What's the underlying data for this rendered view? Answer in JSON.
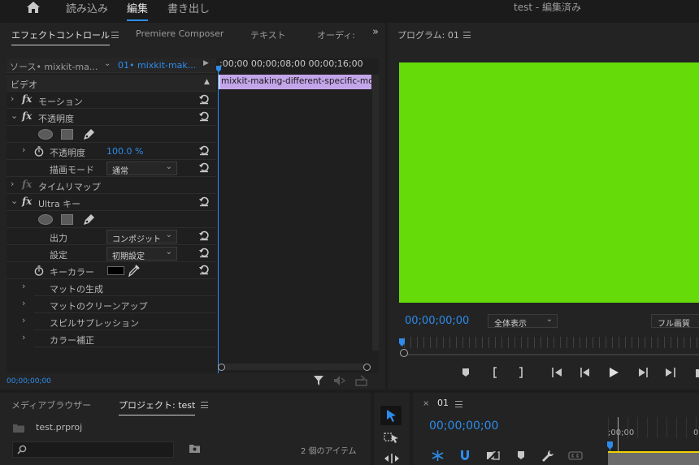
{
  "topbar": {
    "workspaces": [
      "読み込み",
      "編集",
      "書き出し"
    ],
    "active": "編集",
    "title": "test - 編集済み"
  },
  "effect_panel": {
    "tabs": [
      "エフェクトコントロール",
      "Premiere Composer",
      "テキスト",
      "オーディ:"
    ],
    "source_label": "ソース• mixkit-ma...",
    "sequence_label": "01• mixkit-mak...",
    "ruler_text": ";00;00 00;00;08;00 00;00;16;00",
    "clip_name": "mixkit-making-different-specific-mov",
    "section": "ビデオ",
    "rows": {
      "motion": "モーション",
      "opacity": "不透明度",
      "opacity_prop": "不透明度",
      "opacity_value": "100.0 %",
      "blend_mode": "描画モード",
      "blend_value": "通常",
      "time_remap": "タイムリマップ",
      "ultra": "Ultra キー",
      "output": "出力",
      "output_value": "コンポジット",
      "setting": "設定",
      "setting_value": "初期設定",
      "key_color": "キーカラー",
      "matte_gen": "マットの生成",
      "matte_clean": "マットのクリーンアップ",
      "spill": "スピルサプレッション",
      "color_correct": "カラー補正"
    },
    "timecode": "00;00;00;00"
  },
  "program": {
    "title": "プログラム: 01",
    "timecode": "00;00;00;00",
    "zoom": "全体表示",
    "quality": "フル画質",
    "frame_color": "#65dc0a"
  },
  "project": {
    "tabs": [
      "メディアブラウザー",
      "プロジェクト: test"
    ],
    "file": "test.prproj",
    "search_placeholder": "",
    "item_count": "2 個のアイテム"
  },
  "timeline": {
    "close": "×",
    "name": "01",
    "timecode": "00;00;00;00",
    "ruler_start": ";00;00",
    "ruler_next": "0"
  },
  "colors": {
    "accent": "#2d8ceb",
    "clip": "#c3a6ea",
    "green": "#65dc0a"
  }
}
